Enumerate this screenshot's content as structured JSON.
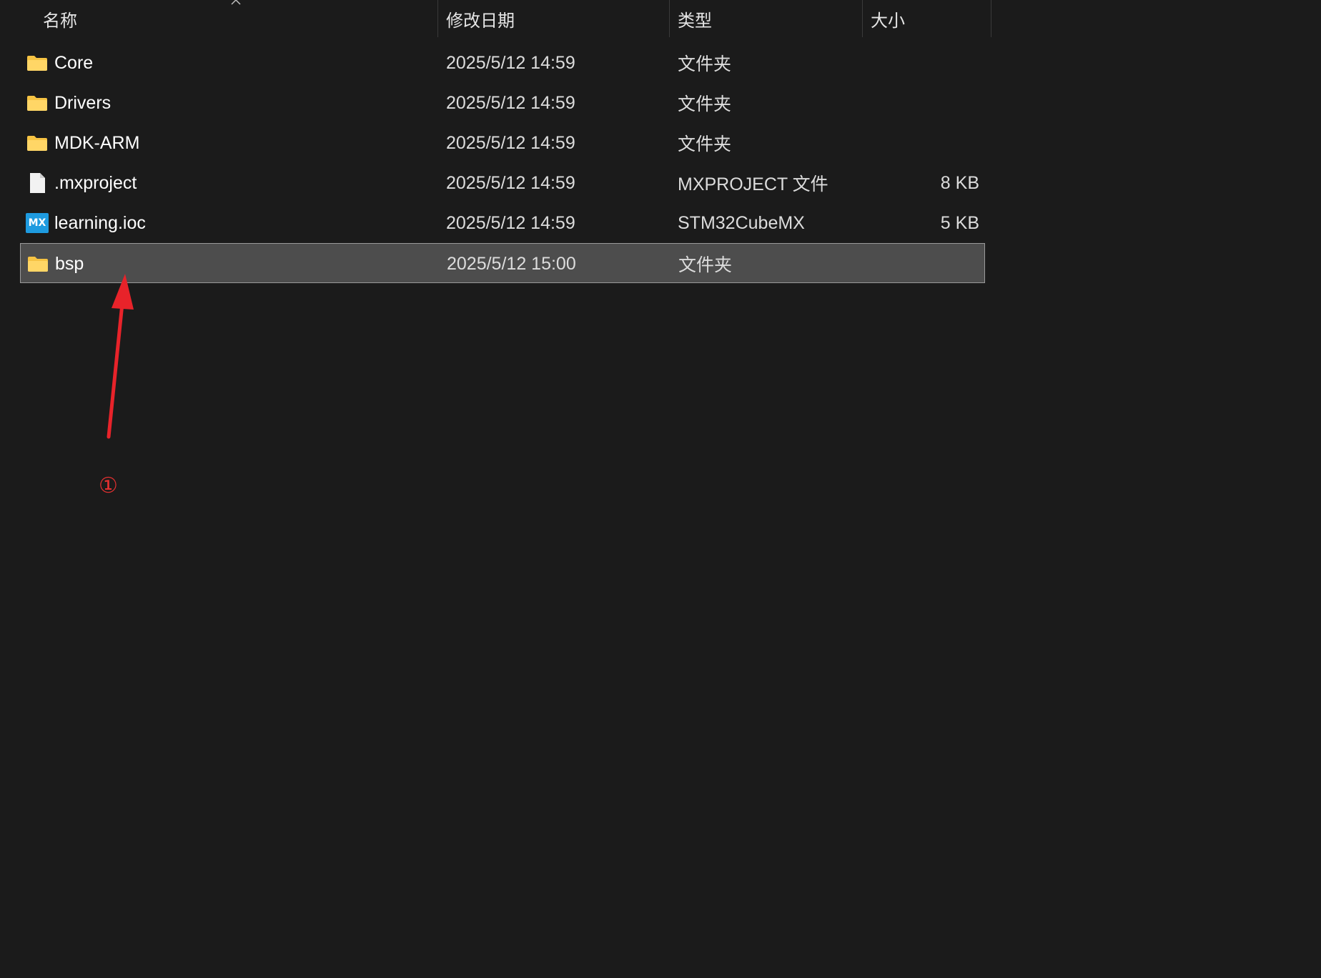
{
  "header": {
    "columns": [
      {
        "key": "name",
        "label": "名称"
      },
      {
        "key": "date",
        "label": "修改日期"
      },
      {
        "key": "type",
        "label": "类型"
      },
      {
        "key": "size",
        "label": "大小"
      }
    ],
    "sorted_column": "name",
    "sort_direction": "ascending"
  },
  "files": [
    {
      "icon": "folder-icon",
      "name": "Core",
      "date": "2025/5/12 14:59",
      "type": "文件夹",
      "size": ""
    },
    {
      "icon": "folder-icon",
      "name": "Drivers",
      "date": "2025/5/12 14:59",
      "type": "文件夹",
      "size": ""
    },
    {
      "icon": "folder-icon",
      "name": "MDK-ARM",
      "date": "2025/5/12 14:59",
      "type": "文件夹",
      "size": ""
    },
    {
      "icon": "file-icon",
      "name": ".mxproject",
      "date": "2025/5/12 14:59",
      "type": "MXPROJECT 文件",
      "size": "8 KB"
    },
    {
      "icon": "stm32cubemx-icon",
      "name": "learning.ioc",
      "date": "2025/5/12 14:59",
      "type": "STM32CubeMX",
      "size": "5 KB",
      "icon_text": "MX"
    },
    {
      "icon": "folder-icon",
      "name": "bsp",
      "date": "2025/5/12 15:00",
      "type": "文件夹",
      "size": "",
      "selected": true
    }
  ],
  "annotation": {
    "label": "①",
    "color": "#e53030"
  },
  "colors": {
    "background": "#1b1b1b",
    "selected_row": "#4d4d4d",
    "folder": "#f6c343",
    "mx_badge": "#1e9be0"
  }
}
